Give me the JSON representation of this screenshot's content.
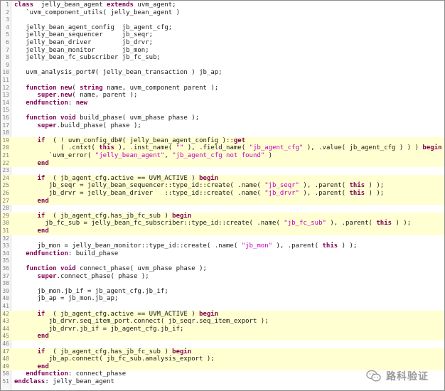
{
  "editor": {
    "lines": [
      {
        "n": "1",
        "hl": false,
        "parts": [
          [
            "kw",
            "class"
          ],
          [
            "",
            "  jelly_bean_agent "
          ],
          [
            "kw",
            "extends"
          ],
          [
            "",
            " uvm_agent;"
          ]
        ]
      },
      {
        "n": "2",
        "hl": false,
        "parts": [
          [
            "",
            "   `uvm_component_utils( jelly_bean_agent )"
          ]
        ]
      },
      {
        "n": "3",
        "hl": false,
        "parts": []
      },
      {
        "n": "4",
        "hl": false,
        "parts": [
          [
            "",
            "   jelly_bean_agent_config  jb_agent_cfg;"
          ]
        ]
      },
      {
        "n": "5",
        "hl": false,
        "parts": [
          [
            "",
            "   jelly_bean_sequencer     jb_seqr;"
          ]
        ]
      },
      {
        "n": "6",
        "hl": false,
        "parts": [
          [
            "",
            "   jelly_bean_driver        jb_drvr;"
          ]
        ]
      },
      {
        "n": "7",
        "hl": false,
        "parts": [
          [
            "",
            "   jelly_bean_monitor       jb_mon;"
          ]
        ]
      },
      {
        "n": "8",
        "hl": false,
        "parts": [
          [
            "",
            "   jelly_bean_fc_subscriber jb_fc_sub;"
          ]
        ]
      },
      {
        "n": "9",
        "hl": false,
        "parts": []
      },
      {
        "n": "10",
        "hl": false,
        "parts": [
          [
            "",
            "   uvm_analysis_port#( jelly_bean_transaction ) jb_ap;"
          ]
        ]
      },
      {
        "n": "11",
        "hl": false,
        "parts": []
      },
      {
        "n": "12",
        "hl": false,
        "parts": [
          [
            "kw",
            "   function"
          ],
          [
            " ",
            " "
          ],
          [
            "kw",
            "new"
          ],
          [
            "",
            "( "
          ],
          [
            "kw",
            "string"
          ],
          [
            "",
            " name, uvm_component parent );"
          ]
        ]
      },
      {
        "n": "13",
        "hl": false,
        "parts": [
          [
            "kw",
            "      super"
          ],
          [
            "",
            "."
          ],
          [
            "kw",
            "new"
          ],
          [
            "",
            "( name, parent );"
          ]
        ]
      },
      {
        "n": "14",
        "hl": false,
        "parts": [
          [
            "kw",
            "   endfunction"
          ],
          [
            "",
            ": "
          ],
          [
            "kw",
            "new"
          ]
        ]
      },
      {
        "n": "15",
        "hl": false,
        "parts": []
      },
      {
        "n": "16",
        "hl": false,
        "parts": [
          [
            "kw",
            "   function"
          ],
          [
            "",
            " "
          ],
          [
            "kw",
            "void"
          ],
          [
            "",
            " build_phase( uvm_phase phase );"
          ]
        ]
      },
      {
        "n": "17",
        "hl": false,
        "parts": [
          [
            "kw",
            "      super"
          ],
          [
            "",
            ".build_phase( phase );"
          ]
        ]
      },
      {
        "n": "18",
        "hl": false,
        "parts": []
      },
      {
        "n": "19",
        "hl": true,
        "parts": [
          [
            "kw",
            "      if"
          ],
          [
            "",
            "  ( ! uvm_config_db#( jelly_bean_agent_config )::"
          ],
          [
            "kw",
            "get"
          ]
        ]
      },
      {
        "n": "20",
        "hl": true,
        "parts": [
          [
            "",
            "            ( .cntxt( "
          ],
          [
            "kw",
            "this"
          ],
          [
            "",
            " ), .inst_name( "
          ],
          [
            "str",
            "\"\""
          ],
          [
            "",
            " ), .field_name( "
          ],
          [
            "str",
            "\"jb_agent_cfg\""
          ],
          [
            "",
            " ), .value( jb_agent_cfg ) ) ) "
          ],
          [
            "kw",
            "begin"
          ]
        ]
      },
      {
        "n": "21",
        "hl": true,
        "parts": [
          [
            "",
            "         `uvm_error( "
          ],
          [
            "str",
            "\"jelly_bean_agent\""
          ],
          [
            "",
            ", "
          ],
          [
            "str",
            "\"jb_agent_cfg not found\""
          ],
          [
            "",
            " )"
          ]
        ]
      },
      {
        "n": "22",
        "hl": true,
        "parts": [
          [
            "kw",
            "      end"
          ]
        ]
      },
      {
        "n": "23",
        "hl": false,
        "parts": []
      },
      {
        "n": "24",
        "hl": true,
        "parts": [
          [
            "kw",
            "      if"
          ],
          [
            "",
            "  ( jb_agent_cfg.active == UVM_ACTIVE ) "
          ],
          [
            "kw",
            "begin"
          ]
        ]
      },
      {
        "n": "25",
        "hl": true,
        "parts": [
          [
            "",
            "         jb_seqr = jelly_bean_sequencer::type_id::create( .name( "
          ],
          [
            "str",
            "\"jb_seqr\""
          ],
          [
            "",
            " ), .parent( "
          ],
          [
            "kw",
            "this"
          ],
          [
            "",
            " ) );"
          ]
        ]
      },
      {
        "n": "26",
        "hl": true,
        "parts": [
          [
            "",
            "         jb_drvr = jelly_bean_driver   ::type_id::create( .name( "
          ],
          [
            "str",
            "\"jb_drvr\""
          ],
          [
            "",
            " ), .parent( "
          ],
          [
            "kw",
            "this"
          ],
          [
            "",
            " ) );"
          ]
        ]
      },
      {
        "n": "27",
        "hl": true,
        "parts": [
          [
            "kw",
            "      end"
          ]
        ]
      },
      {
        "n": "28",
        "hl": false,
        "parts": []
      },
      {
        "n": "29",
        "hl": true,
        "parts": [
          [
            "kw",
            "      if"
          ],
          [
            "",
            "  ( jb_agent_cfg.has_jb_fc_sub ) "
          ],
          [
            "kw",
            "begin"
          ]
        ]
      },
      {
        "n": "30",
        "hl": true,
        "parts": [
          [
            "",
            "        jb_fc_sub = jelly_bean_fc_subscriber::type_id::create( .name( "
          ],
          [
            "str",
            "\"jb_fc_sub\""
          ],
          [
            "",
            " ), .parent( "
          ],
          [
            "kw",
            "this"
          ],
          [
            "",
            " ) );"
          ]
        ]
      },
      {
        "n": "31",
        "hl": true,
        "parts": [
          [
            "kw",
            "      end"
          ]
        ]
      },
      {
        "n": "32",
        "hl": false,
        "parts": []
      },
      {
        "n": "33",
        "hl": false,
        "parts": [
          [
            "",
            "      jb_mon = jelly_bean_monitor::type_id::create( .name( "
          ],
          [
            "str",
            "\"jb_mon\""
          ],
          [
            "",
            " ), .parent( "
          ],
          [
            "kw",
            "this"
          ],
          [
            "",
            " ) );"
          ]
        ]
      },
      {
        "n": "34",
        "hl": false,
        "parts": [
          [
            "kw",
            "   endfunction"
          ],
          [
            "",
            ": build_phase"
          ]
        ]
      },
      {
        "n": "35",
        "hl": false,
        "parts": []
      },
      {
        "n": "36",
        "hl": false,
        "parts": [
          [
            "kw",
            "   function"
          ],
          [
            "",
            " "
          ],
          [
            "kw",
            "void"
          ],
          [
            "",
            " connect_phase( uvm_phase phase );"
          ]
        ]
      },
      {
        "n": "37",
        "hl": false,
        "parts": [
          [
            "kw",
            "      super"
          ],
          [
            "",
            ".connect_phase( phase );"
          ]
        ]
      },
      {
        "n": "38",
        "hl": false,
        "parts": []
      },
      {
        "n": "39",
        "hl": false,
        "parts": [
          [
            "",
            "      jb_mon.jb_if = jb_agent_cfg.jb_if;"
          ]
        ]
      },
      {
        "n": "40",
        "hl": false,
        "parts": [
          [
            "",
            "      jb_ap = jb_mon.jb_ap;"
          ]
        ]
      },
      {
        "n": "41",
        "hl": false,
        "parts": []
      },
      {
        "n": "42",
        "hl": true,
        "parts": [
          [
            "kw",
            "      if"
          ],
          [
            "",
            "  ( jb_agent_cfg.active == UVM_ACTIVE ) "
          ],
          [
            "kw",
            "begin"
          ]
        ]
      },
      {
        "n": "43",
        "hl": true,
        "parts": [
          [
            "",
            "         jb_drvr.seq_item_port.connect( jb_seqr.seq_item_export );"
          ]
        ]
      },
      {
        "n": "44",
        "hl": true,
        "parts": [
          [
            "",
            "         jb_drvr.jb_if = jb_agent_cfg.jb_if;"
          ]
        ]
      },
      {
        "n": "45",
        "hl": true,
        "parts": [
          [
            "kw",
            "      end"
          ]
        ]
      },
      {
        "n": "46",
        "hl": false,
        "parts": []
      },
      {
        "n": "47",
        "hl": true,
        "parts": [
          [
            "kw",
            "      if"
          ],
          [
            "",
            "  ( jb_agent_cfg.has_jb_fc_sub ) "
          ],
          [
            "kw",
            "begin"
          ]
        ]
      },
      {
        "n": "48",
        "hl": true,
        "parts": [
          [
            "",
            "         jb_ap.connect( jb_fc_sub.analysis_export );"
          ]
        ]
      },
      {
        "n": "49",
        "hl": true,
        "parts": [
          [
            "kw",
            "      end"
          ]
        ]
      },
      {
        "n": "50",
        "hl": false,
        "parts": [
          [
            "kw",
            "   endfunction"
          ],
          [
            "",
            ": connect_phase"
          ]
        ]
      },
      {
        "n": "51",
        "hl": false,
        "parts": [
          [
            "kw",
            "endclass"
          ],
          [
            "",
            ": jelly_bean_agent"
          ]
        ]
      }
    ]
  },
  "watermark": {
    "text": "路科验证",
    "icon": "wechat-icon",
    "color": "#9a9a9a"
  },
  "colors": {
    "keyword": "#7f0055",
    "string": "#c000c0",
    "highlight": "#ffffd2"
  }
}
